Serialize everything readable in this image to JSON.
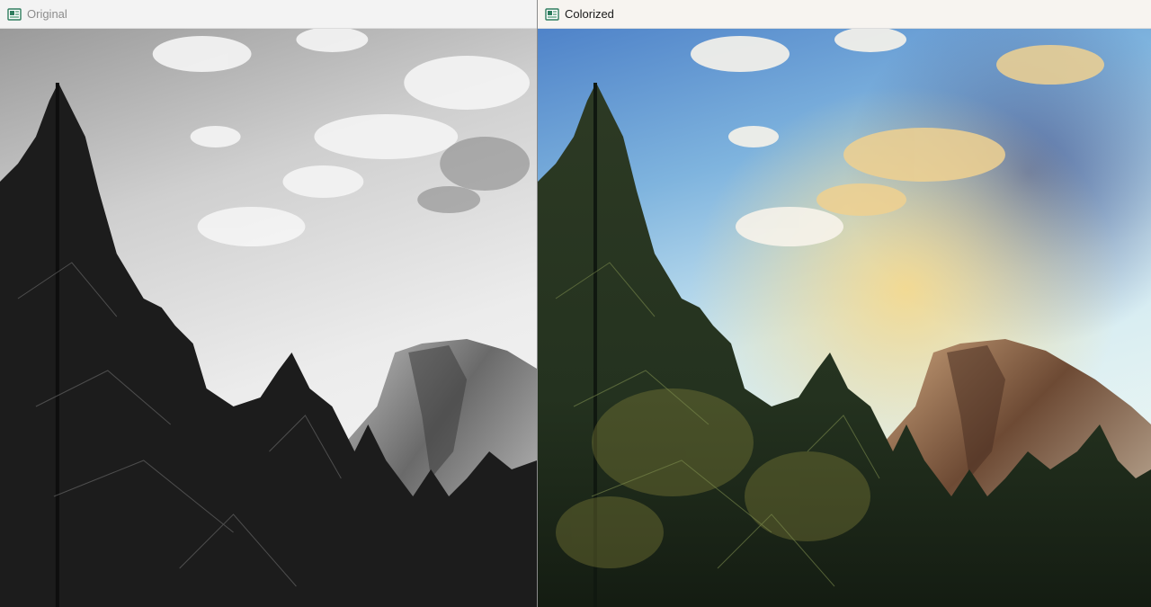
{
  "windows": {
    "original": {
      "title": "Original",
      "icon": "opencv-window-icon",
      "state": "inactive"
    },
    "colorized": {
      "title": "Colorized",
      "icon": "opencv-window-icon",
      "state": "active"
    }
  },
  "image": {
    "content": "landscape: coniferous trees in foreground with granite dome and cloudy sky",
    "original_mode": "grayscale",
    "colorized_mode": "color"
  },
  "colors": {
    "sky_top_blue": "#4f83c9",
    "sky_horizon": "#dff3f5",
    "glow_yellow": "#f1d58a",
    "dome_brown": "#8a6446",
    "tree_dark": "#1b2418",
    "tree_green": "#4b5a2c",
    "gray_sky": "#d9d9d9",
    "gray_tree": "#1c1c1c"
  }
}
